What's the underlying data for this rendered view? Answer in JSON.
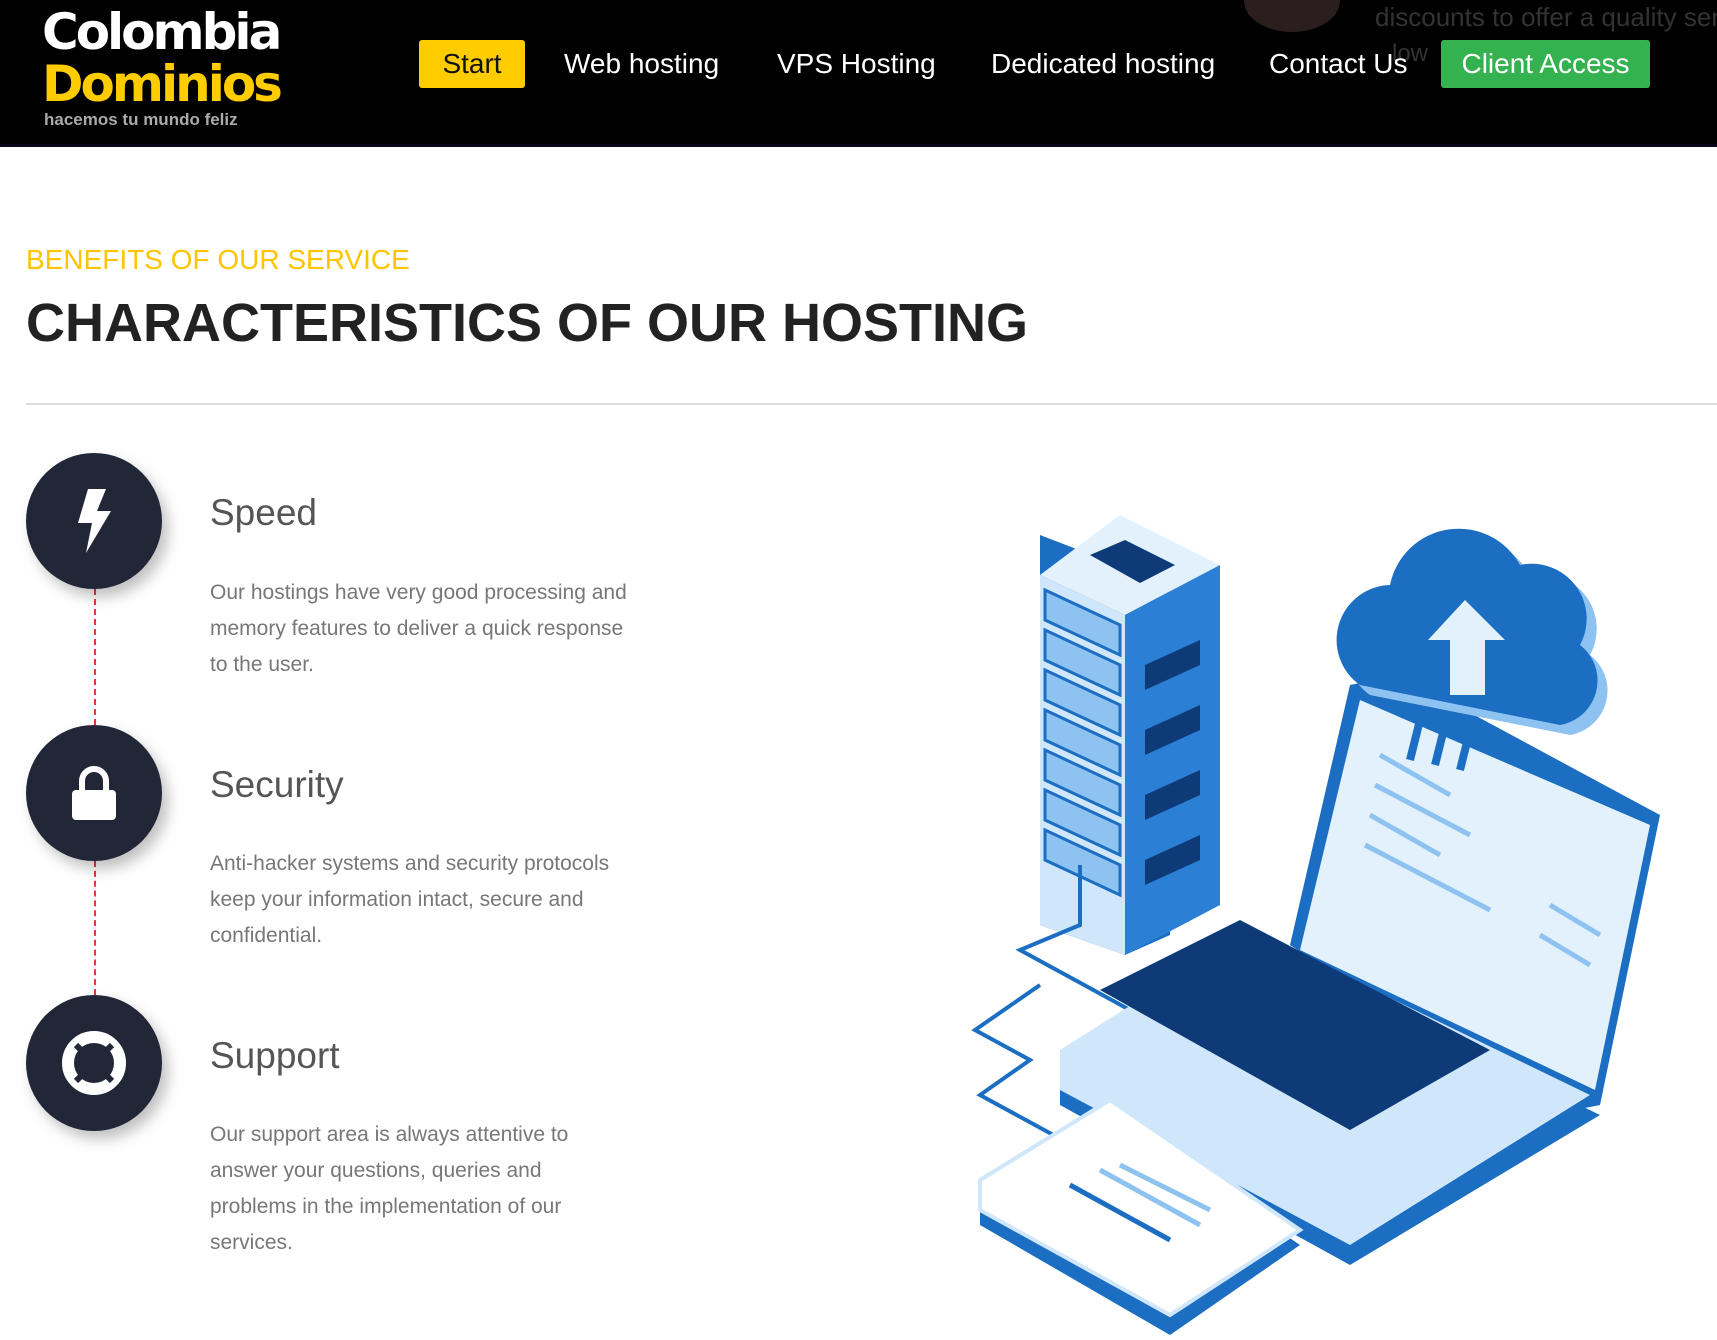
{
  "brand": {
    "line1": "Colombia",
    "line2": "Dominios",
    "tagline": "hacemos tu mundo feliz"
  },
  "nav": {
    "items": [
      {
        "label": "Start",
        "active": true
      },
      {
        "label": "Web hosting"
      },
      {
        "label": "VPS Hosting"
      },
      {
        "label": "Dedicated hosting"
      },
      {
        "label": "Contact Us"
      }
    ],
    "client_access": "Client Access"
  },
  "background_text": {
    "line1": "discounts to offer a quality servi",
    "line2": "low"
  },
  "section": {
    "eyebrow": "BENEFITS OF OUR SERVICE",
    "title": "CHARACTERISTICS OF OUR HOSTING"
  },
  "features": [
    {
      "icon": "lightning-icon",
      "title": "Speed",
      "body": "Our hostings have very good processing and memory features to deliver a quick response to the user."
    },
    {
      "icon": "lock-icon",
      "title": "Security",
      "body": "Anti-hacker systems and security protocols keep your information intact, secure and confidential."
    },
    {
      "icon": "lifebuoy-icon",
      "title": "Support",
      "body": "Our support area is always attentive to answer your questions, queries and problems in the implementation of our services."
    }
  ],
  "colors": {
    "accent_yellow": "#ffcc00",
    "client_green": "#33b24f",
    "icon_circle": "#222738",
    "connector_red": "#e03a3a"
  }
}
